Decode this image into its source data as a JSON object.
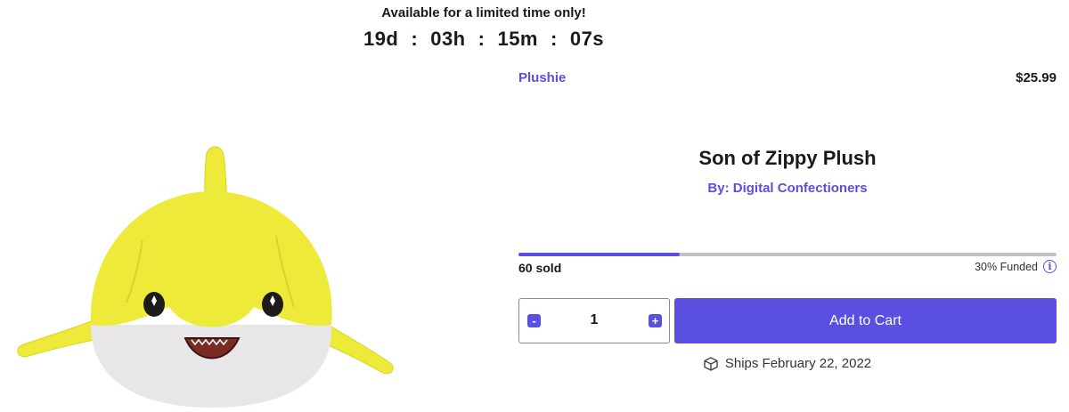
{
  "banner": {
    "text": "Available for a limited time only!",
    "countdown": {
      "days": "19d",
      "hours": "03h",
      "minutes": "15m",
      "seconds": "07s",
      "separator": ":"
    }
  },
  "product": {
    "category": "Plushie",
    "price": "$25.99",
    "title": "Son of Zippy Plush",
    "creator": "By: Digital Confectioners",
    "sold": "60 sold",
    "funded": "30% Funded",
    "funded_fraction": 0.3,
    "info_glyph": "i",
    "image_icon": "yellow-shark-plush"
  },
  "cart": {
    "minus": "-",
    "plus": "+",
    "quantity": "1",
    "add_label": "Add to Cart"
  },
  "shipping": {
    "text": "Ships February 22, 2022",
    "icon": "box-icon"
  },
  "colors": {
    "accent": "#5a4fe0",
    "track": "#c2c2c2",
    "text": "#1a1a1a"
  }
}
